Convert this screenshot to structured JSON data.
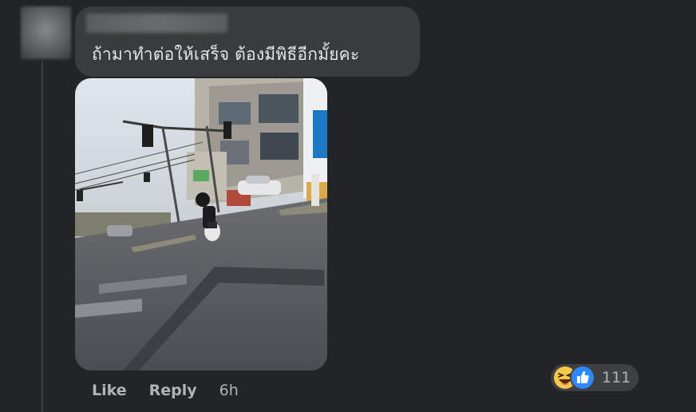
{
  "comment": {
    "author_name": "",
    "text": "ถ้ามาทำต่อให้เสร็จ ต้องมีพิธีอีกมั้ยคะ",
    "photo_description_icon": "street-photo"
  },
  "actions": {
    "like_label": "Like",
    "reply_label": "Reply",
    "timestamp": "6h"
  },
  "reactions": {
    "icons": [
      "haha-icon",
      "like-icon"
    ],
    "count": "111"
  },
  "colors": {
    "background": "#232426",
    "bubble": "#3a3b3c",
    "text_primary": "#e4e6eb",
    "text_secondary": "#b0b3b8",
    "like_blue": "#2e89ff",
    "haha_yellow": "#f7c84b"
  }
}
